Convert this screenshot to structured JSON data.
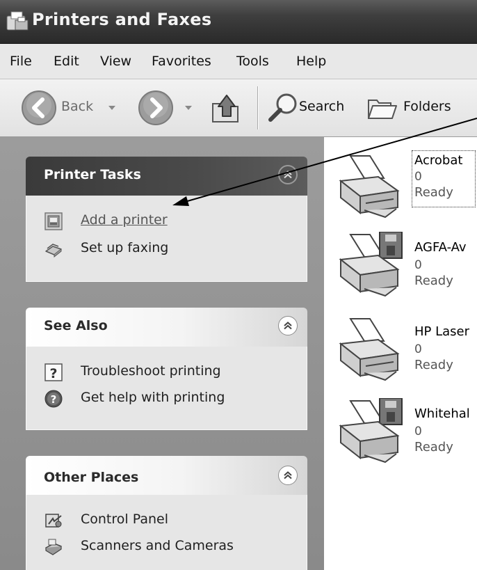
{
  "window": {
    "title": "Printers and Faxes"
  },
  "menu": {
    "items": [
      "File",
      "Edit",
      "View",
      "Favorites",
      "Tools",
      "Help"
    ]
  },
  "toolbar": {
    "back_label": "Back",
    "search_label": "Search",
    "folders_label": "Folders"
  },
  "taskpane": {
    "printer_tasks": {
      "title": "Printer Tasks",
      "items": [
        {
          "label": "Add a printer",
          "icon": "add-printer-icon"
        },
        {
          "label": "Set up faxing",
          "icon": "fax-icon"
        }
      ]
    },
    "see_also": {
      "title": "See Also",
      "items": [
        {
          "label": "Troubleshoot printing",
          "icon": "troubleshoot-icon"
        },
        {
          "label": "Get help with printing",
          "icon": "help-icon"
        }
      ]
    },
    "other_places": {
      "title": "Other Places",
      "items": [
        {
          "label": "Control Panel",
          "icon": "control-panel-icon"
        },
        {
          "label": "Scanners and Cameras",
          "icon": "scanner-icon"
        }
      ]
    }
  },
  "printers": [
    {
      "name": "Acrobat",
      "jobs": "0",
      "status": "Ready",
      "icon": "printer-icon",
      "selected": true
    },
    {
      "name": "AGFA-Av",
      "jobs": "0",
      "status": "Ready",
      "icon": "network-printer-icon",
      "selected": false
    },
    {
      "name": "HP Laser",
      "jobs": "0",
      "status": "Ready",
      "icon": "printer-icon",
      "selected": false
    },
    {
      "name": "Whitehal",
      "jobs": "0",
      "status": "Ready",
      "icon": "network-printer-icon",
      "selected": false
    }
  ],
  "colors": {
    "titlebar": "#3f3f3f",
    "taskpane_bg": "#939393",
    "panel_body": "#e6e6e6",
    "annotation_arrow": "#000000"
  }
}
